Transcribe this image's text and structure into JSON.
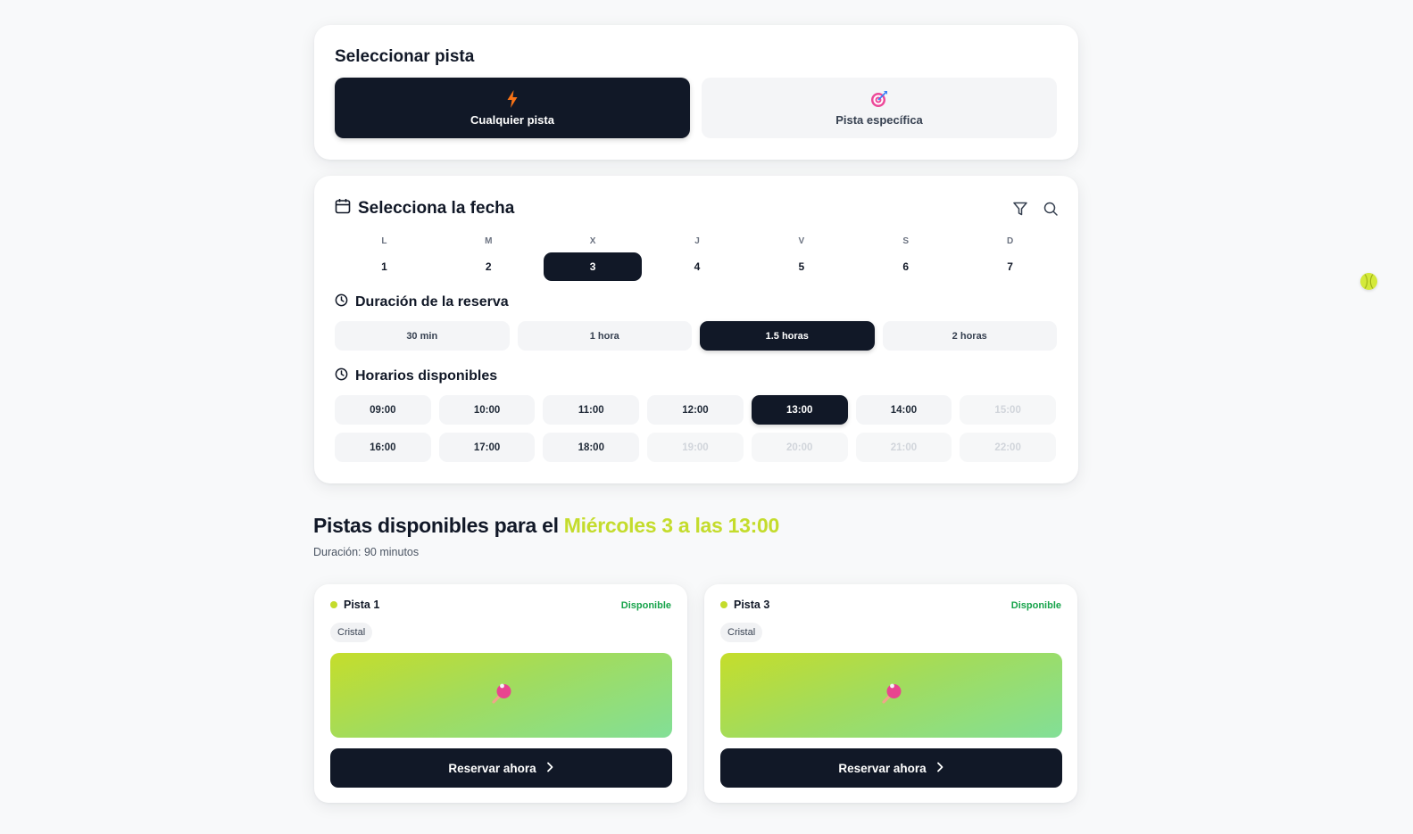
{
  "court_select": {
    "title": "Seleccionar pista",
    "options": [
      {
        "label": "Cualquier pista",
        "icon": "lightning-icon",
        "selected": true
      },
      {
        "label": "Pista específica",
        "icon": "target-icon",
        "selected": false
      }
    ]
  },
  "date_select": {
    "title": "Selecciona la fecha",
    "icons": [
      "calendar-icon",
      "filter-icon",
      "search-icon"
    ],
    "days": [
      {
        "letter": "L",
        "num": "1"
      },
      {
        "letter": "M",
        "num": "2"
      },
      {
        "letter": "X",
        "num": "3",
        "selected": true
      },
      {
        "letter": "J",
        "num": "4"
      },
      {
        "letter": "V",
        "num": "5"
      },
      {
        "letter": "S",
        "num": "6"
      },
      {
        "letter": "D",
        "num": "7"
      }
    ]
  },
  "duration": {
    "title": "Duración de la reserva",
    "icon": "clock-icon",
    "options": [
      "30 min",
      "1 hora",
      "1.5 horas",
      "2 horas"
    ],
    "selected": "1.5 horas"
  },
  "slots": {
    "title": "Horarios disponibles",
    "icon": "clock-icon",
    "items": [
      {
        "time": "09:00",
        "state": "available"
      },
      {
        "time": "10:00",
        "state": "available"
      },
      {
        "time": "11:00",
        "state": "available"
      },
      {
        "time": "12:00",
        "state": "available"
      },
      {
        "time": "13:00",
        "state": "selected"
      },
      {
        "time": "14:00",
        "state": "available"
      },
      {
        "time": "15:00",
        "state": "disabled"
      },
      {
        "time": "16:00",
        "state": "available"
      },
      {
        "time": "17:00",
        "state": "available"
      },
      {
        "time": "18:00",
        "state": "available"
      },
      {
        "time": "19:00",
        "state": "disabled"
      },
      {
        "time": "20:00",
        "state": "disabled"
      },
      {
        "time": "21:00",
        "state": "disabled"
      },
      {
        "time": "22:00",
        "state": "disabled"
      }
    ]
  },
  "results": {
    "title_prefix": "Pistas disponibles para el ",
    "title_highlight": "Miércoles 3 a las 13:00",
    "subtitle": "Duración: 90 minutos",
    "courts": [
      {
        "name": "Pista 1",
        "status": "Disponible",
        "tag": "Cristal",
        "button": "Reservar ahora",
        "image_icon": "ping-pong-paddle-icon"
      },
      {
        "name": "Pista 3",
        "status": "Disponible",
        "tag": "Cristal",
        "button": "Reservar ahora",
        "image_icon": "ping-pong-paddle-icon"
      }
    ]
  },
  "colors": {
    "dark": "#111827",
    "accent": "#c4dc2c",
    "status_green": "#16a34a",
    "chip_bg": "#f4f5f7"
  },
  "floating": {
    "icon": "tennis-ball-icon"
  }
}
